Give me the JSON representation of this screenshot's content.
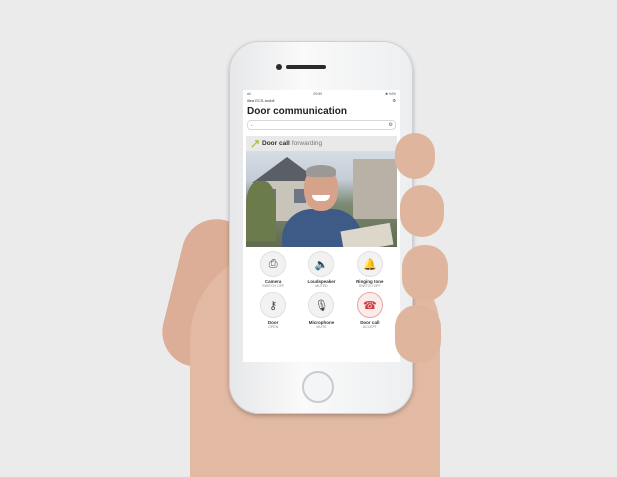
{
  "status_bar": {
    "signal": "all",
    "time": "09:50",
    "battery": "✱ 94%"
  },
  "app_bar": {
    "name": "illea ECS-mobil",
    "settings_icon": "gear-icon"
  },
  "page": {
    "title": "Door communication"
  },
  "search": {
    "back_icon": "back-arrow-icon",
    "gear_icon": "gear-icon"
  },
  "banner": {
    "highlight": "Door call",
    "text": "forwarding"
  },
  "controls": [
    {
      "label": "Camera",
      "sub": "SWITCH OFF",
      "icon": "camera-icon",
      "glyph": "⎙"
    },
    {
      "label": "Loudspeaker",
      "sub": "MUTED",
      "icon": "speaker-icon",
      "glyph": "🔈"
    },
    {
      "label": "Ringing tone",
      "sub": "SWITCH OFF",
      "icon": "bell-icon",
      "glyph": "🔔"
    },
    {
      "label": "Door",
      "sub": "OPEN",
      "icon": "key-icon",
      "glyph": "⚷"
    },
    {
      "label": "Microphone",
      "sub": "MUTE",
      "icon": "microphone-icon",
      "glyph": "🎙"
    },
    {
      "label": "Door call",
      "sub": "ACCEPT",
      "icon": "phone-icon",
      "glyph": "☎"
    }
  ],
  "colors": {
    "background": "#ebebec",
    "accept_red": "#d23b3b",
    "banner": "#e9e9e9"
  }
}
